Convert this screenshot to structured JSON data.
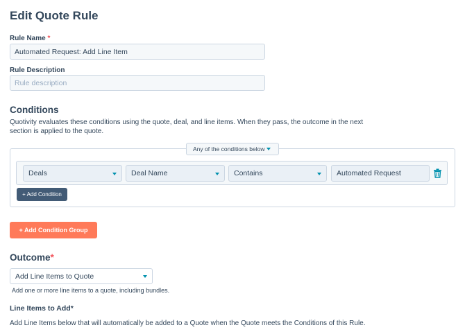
{
  "page": {
    "title": "Edit Quote Rule"
  },
  "rule_name": {
    "label": "Rule Name",
    "required_mark": "*",
    "value": "Automated Request: Add Line Item"
  },
  "rule_description": {
    "label": "Rule Description",
    "placeholder": "Rule description"
  },
  "conditions": {
    "title": "Conditions",
    "help_line1": "Quotivity evaluates these conditions using the quote, deal, and line items. When they pass, the outcome in the next",
    "help_line2": "section is applied to the quote.",
    "group_match": "Any of the conditions below",
    "rows": [
      {
        "object": "Deals",
        "property": "Deal Name",
        "operator": "Contains",
        "value": "Automated Request"
      }
    ],
    "add_condition_label": "+ Add Condition",
    "add_group_label": "+ Add Condition Group",
    "delete_icon": "trash-icon"
  },
  "outcome": {
    "title": "Outcome",
    "required_mark": "*",
    "selected": "Add Line Items to Quote",
    "help": "Add one or more line items to a quote, including bundles."
  },
  "line_items": {
    "title": "Line Items to Add*",
    "help": "Add Line Items below that will automatically be added to a Quote when the Quote meets the Conditions of this Rule."
  },
  "colors": {
    "accent": "#ff7a59",
    "dark_button": "#425b76",
    "teal": "#0091ae",
    "text": "#33475b"
  }
}
